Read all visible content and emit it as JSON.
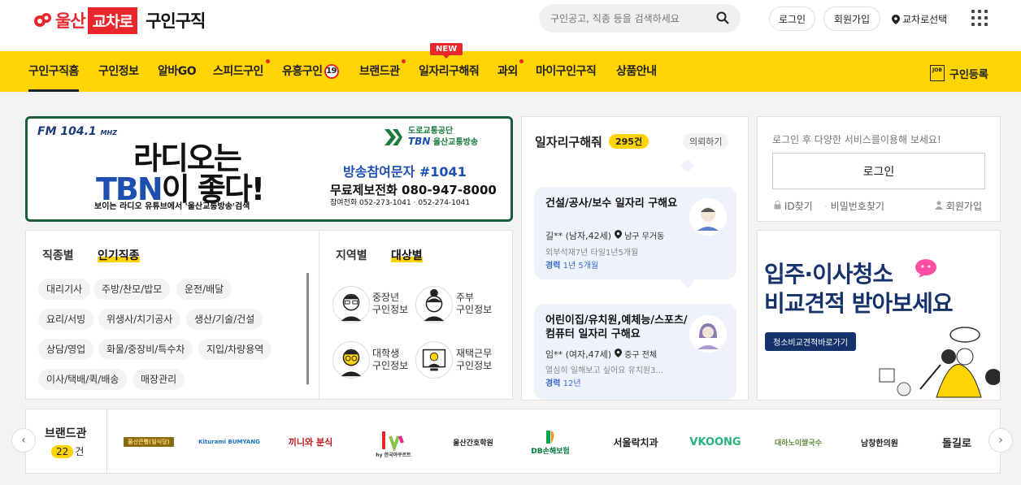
{
  "header": {
    "logo_city": "울산",
    "logo_box": "교차로",
    "logo_sub": "구인구직",
    "search_placeholder": "구인공고, 직종 등을 검색하세요",
    "login": "로그인",
    "signup": "회원가입",
    "location": "교차로선택"
  },
  "nav": {
    "items": [
      "구인구직홈",
      "구인정보",
      "알바GO",
      "스피드구인",
      "유흥구인",
      "브랜드관",
      "일자리구해줘",
      "과외",
      "마이구인구직",
      "상품안내"
    ],
    "badge19": "19",
    "new_tag": "NEW",
    "job_register": "구인등록",
    "job_icon_text": "JOB"
  },
  "banner": {
    "fm": "FM 104.1",
    "fm_unit": "MHZ",
    "headline_a": "라디오는",
    "headline_b": "TBN",
    "headline_c": "이 좋다!",
    "subline": "보이는 라디오 유튜브에서 '울산교통방송'검색",
    "org": "도로교통공단",
    "org_sub": "울산교통방송",
    "tbn": "TBN",
    "sms": "방송참여문자 #1041",
    "tel": "무료제보전화 080-947-8000",
    "tel2": "참여전화  052-273-1041 · 052-274-1041"
  },
  "categories": {
    "tab1": "직종별",
    "tab2": "인기직종",
    "chips": [
      "대리기사",
      "주방/찬모/밥모",
      "운전/배달",
      "요리/서빙",
      "위생사/치기공사",
      "생산/기술/건설",
      "상담/영업",
      "화물/중장비/특수차",
      "지입/차량용역",
      "이사/택배/퀵/배송",
      "매장관리"
    ],
    "tab3": "지역별",
    "tab4": "대상별",
    "targets": [
      {
        "l1": "중장년",
        "l2": "구인정보"
      },
      {
        "l1": "주부",
        "l2": "구인정보"
      },
      {
        "l1": "대학생",
        "l2": "구인정보"
      },
      {
        "l1": "재택근무",
        "l2": "구인정보"
      }
    ]
  },
  "jobs": {
    "title": "일자리구해줘",
    "count": "295건",
    "view_all": "의뢰하기",
    "items": [
      {
        "title": "건설/공사/보수 일자리 구해요",
        "name": "길** (남자,42세)",
        "loc": "남구 무거동",
        "desc": "외부석재7년 타일1년5개월",
        "exp_label": "경력",
        "exp": "1년 5개월"
      },
      {
        "title": "어린이집/유치원,예체능/스포츠/컴퓨터 일자리 구해요",
        "name": "임** (여자,47세)",
        "loc": "중구 전체",
        "desc": "열심히 일해보고 싶어요 유치원3...",
        "exp_label": "경력",
        "exp": "12년"
      }
    ]
  },
  "login_box": {
    "message": "로그인 후 다양한 서비스를이용해 보세요!",
    "button": "로그인",
    "find_id": "ID찾기",
    "find_pw": "비밀번호찾기",
    "signup": "회원가입"
  },
  "ad": {
    "line1": "입주·이사청소",
    "line2": "비교견적 받아보세요",
    "cta": "청소비교견적바로가기"
  },
  "brand": {
    "title": "브랜드관",
    "count": "22",
    "count_unit": "건",
    "logos": [
      "울산큰빵(일식당)",
      "Kiturami BUMYANG",
      "끼니와 분식",
      "hy 한국야쿠르트",
      "울산간호학원",
      "DB손해보험",
      "서울락치과",
      "VKOONG",
      "대하노이쌀국수",
      "남창한의원",
      "돌길로"
    ]
  }
}
